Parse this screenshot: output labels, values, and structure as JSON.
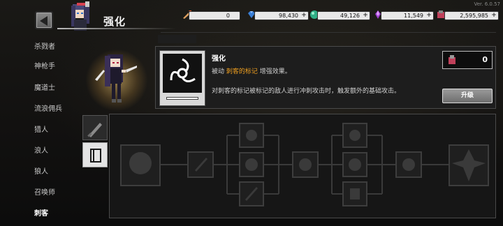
{
  "app": {
    "version": "Ver. 6.0.57",
    "page_title": "强化"
  },
  "resources": [
    {
      "name": "energy",
      "value": "0",
      "icon": "sword-flame-icon",
      "color": "#e0a060"
    },
    {
      "name": "gems",
      "value": "98,430",
      "icon": "blue-gem-icon",
      "color": "#3a7fd6"
    },
    {
      "name": "orbs",
      "value": "49,126",
      "icon": "green-orb-icon",
      "color": "#2fae86"
    },
    {
      "name": "crystals",
      "value": "11,549",
      "icon": "purple-crystal-icon",
      "color": "#a040d0"
    },
    {
      "name": "coins",
      "value": "2,595,985",
      "icon": "red-coin-icon",
      "color": "#c0405a"
    }
  ],
  "sidebar": {
    "items": [
      {
        "label": "杀戮者"
      },
      {
        "label": "神枪手"
      },
      {
        "label": "魔道士"
      },
      {
        "label": "流浪佣兵"
      },
      {
        "label": "猎人"
      },
      {
        "label": "浪人"
      },
      {
        "label": "狼人"
      },
      {
        "label": "召唤师"
      },
      {
        "label": "刺客",
        "active": true
      }
    ]
  },
  "skill": {
    "name": "强化",
    "line1_prefix": "被动",
    "line1_highlight": "刺客的标记",
    "line1_suffix": "增强效果。",
    "description": "对刺客的标记被标记的敌人进行冲刺攻击时，触发额外的基础攻击。",
    "icon": "shuriken-swirl-icon",
    "cost_value": "0",
    "cost_icon": "red-coin-icon",
    "upgrade_label": "升级"
  },
  "tabs": [
    {
      "name": "weapon",
      "icon": "sword-icon"
    },
    {
      "name": "skills",
      "icon": "book-icon",
      "active": true
    }
  ],
  "colors": {
    "accent": "#f0a020",
    "panel_bg": "#1d1d1d"
  }
}
